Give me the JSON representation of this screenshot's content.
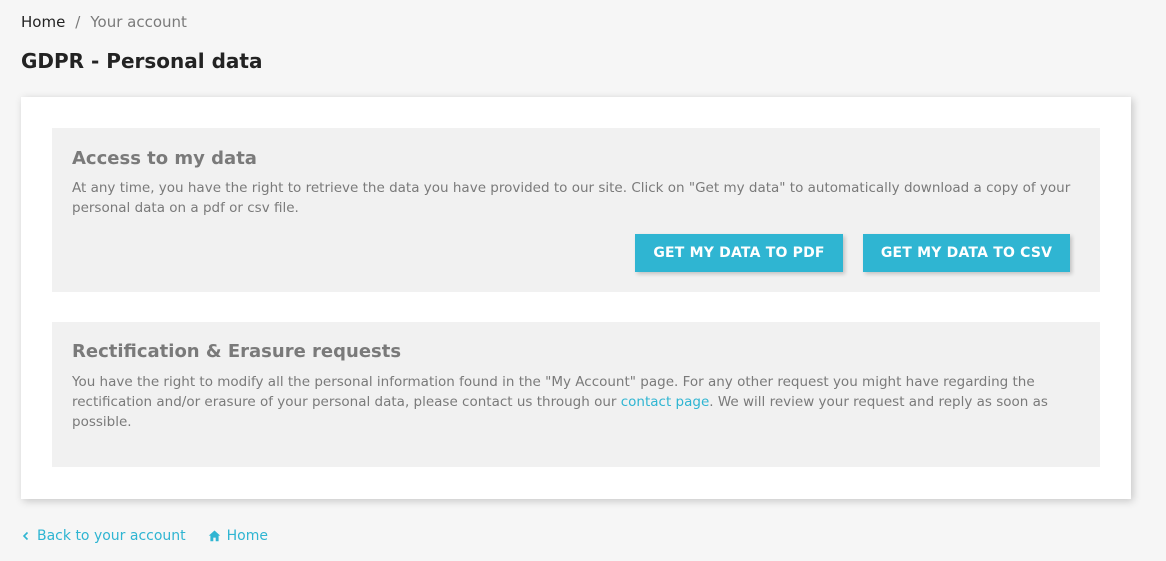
{
  "breadcrumb": {
    "home": "Home",
    "separator": "/",
    "current": "Your account"
  },
  "page": {
    "title": "GDPR - Personal data"
  },
  "access": {
    "title": "Access to my data",
    "text": "At any time, you have the right to retrieve the data you have provided to our site. Click on \"Get my data\" to automatically download a copy of your personal data on a pdf or csv file.",
    "pdf_button": "GET MY DATA TO PDF",
    "csv_button": "GET MY DATA TO CSV"
  },
  "rectification": {
    "title": "Rectification & Erasure requests",
    "text_before": "You have the right to modify all the personal information found in the \"My Account\" page. For any other request you might have regarding the rectification and/or erasure of your personal data, please contact us through our ",
    "link": "contact page",
    "text_after": ". We will review your request and reply as soon as possible."
  },
  "footer": {
    "back_label": "Back to your account",
    "back_icon": "chevron-left-icon",
    "home_label": "Home",
    "home_icon": "home-icon"
  },
  "colors": {
    "accent": "#2fb5d2",
    "muted_text": "#7a7a7a",
    "heading_text": "#232323",
    "block_bg": "#f1f1f1",
    "page_bg": "#f6f6f6"
  }
}
